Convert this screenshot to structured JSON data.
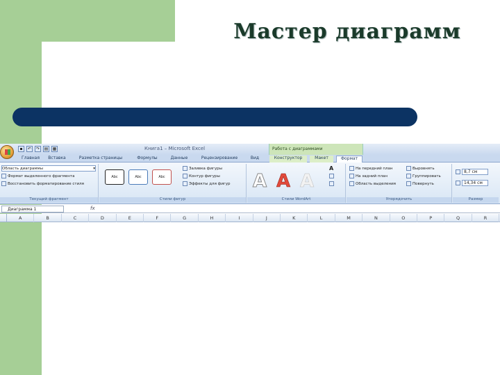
{
  "slide": {
    "title": "Мастер диаграмм"
  },
  "excel": {
    "window_title_parts": [
      "Книга1",
      "Microsoft Excel"
    ],
    "context_group": "Работа с диаграммами",
    "tabs": [
      "Главная",
      "Вставка",
      "Разметка страницы",
      "Формулы",
      "Данные",
      "Рецензирование",
      "Вид",
      "Конструктор",
      "Макет",
      "Формат"
    ],
    "active_tab": "Формат",
    "ribbon": {
      "current_selection": {
        "dropdown": "Область диаграммы",
        "items": [
          "Формат выделенного фрагмента",
          "Восстановить форматирование стиля"
        ],
        "label": "Текущий фрагмент"
      },
      "shape_styles": {
        "preview_labels": [
          "Abc",
          "Abc",
          "Abc"
        ],
        "items": [
          "Заливка фигуры",
          "Контур фигуры",
          "Эффекты для фигур"
        ],
        "label": "Стили фигур"
      },
      "wordart": {
        "glyph": "A",
        "label": "Стили WordArt"
      },
      "arrange": {
        "col1": [
          "На передний план",
          "На задний план",
          "Область выделения"
        ],
        "col2": [
          "Выровнять",
          "Группировать",
          "Повернуть"
        ],
        "label": "Упорядочить"
      },
      "size": {
        "height": "8,7 см",
        "width": "14,34 см",
        "label": "Размер"
      }
    },
    "formula_bar": {
      "name_box": "Диаграмма 1",
      "fx": "fx"
    },
    "columns": [
      "A",
      "B",
      "C",
      "D",
      "E",
      "F",
      "G",
      "H",
      "I",
      "J",
      "K",
      "L",
      "M",
      "N",
      "O",
      "P",
      "Q",
      "R"
    ]
  },
  "colors": {
    "slide_green": "#a6cf96",
    "bar_navy": "#0c3363",
    "ribbon_blue": "#d8e6f5"
  }
}
